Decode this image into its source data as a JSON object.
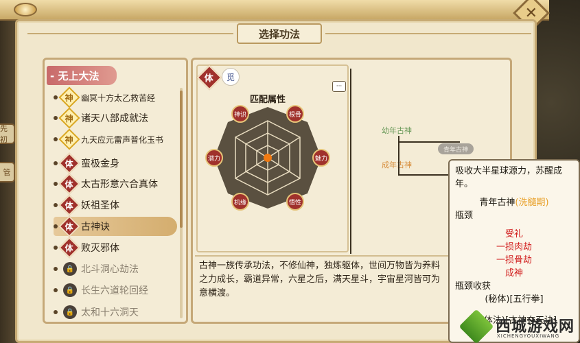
{
  "header": {
    "title": "选择功法",
    "close_icon": "close-x-icon"
  },
  "left_tabs": [
    "先初",
    "管"
  ],
  "list": {
    "section_label": "- 无上大法",
    "items": [
      {
        "badge": "神",
        "kind": "shen",
        "label": "幽冥十方太乙救苦经",
        "small": true,
        "locked": false
      },
      {
        "badge": "神",
        "kind": "shen",
        "label": "诸天八部成就法",
        "small": false,
        "locked": false
      },
      {
        "badge": "神",
        "kind": "shen",
        "label": "九天应元雷声普化玉书",
        "small": true,
        "locked": false
      },
      {
        "badge": "体",
        "kind": "ti",
        "label": "蛮极金身",
        "small": false,
        "locked": false
      },
      {
        "badge": "体",
        "kind": "ti",
        "label": "太古形意六合真体",
        "small": false,
        "locked": false
      },
      {
        "badge": "体",
        "kind": "ti",
        "label": "妖祖圣体",
        "small": false,
        "locked": false
      },
      {
        "badge": "体",
        "kind": "ti",
        "label": "古神诀",
        "small": false,
        "locked": false,
        "selected": true
      },
      {
        "badge": "体",
        "kind": "ti",
        "label": "败灭邪体",
        "small": false,
        "locked": false
      },
      {
        "badge": "",
        "kind": "lock",
        "label": "北斗洞心劫法",
        "small": false,
        "locked": true
      },
      {
        "badge": "",
        "kind": "lock",
        "label": "长生六道轮回经",
        "small": false,
        "locked": true
      },
      {
        "badge": "",
        "kind": "lock",
        "label": "太和十六洞天",
        "small": false,
        "locked": true
      }
    ]
  },
  "detail": {
    "type_badge": "体",
    "stamp": "觅",
    "attr_title": "匹配属性",
    "chat_icon": "···",
    "radar_labels": [
      "神识",
      "根骨",
      "魅力",
      "悟性",
      "机缘",
      "潜力"
    ],
    "description": "古神一族传承功法，不修仙神，独炼躯体，世间万物皆为养料\n之力成长，霸道异常，六星之后，满天星斗，宇宙星河皆可为\n意横渡。",
    "stages": {
      "young": "幼年古神",
      "adult": "成年古神",
      "pill": "青年古神"
    }
  },
  "tooltip": {
    "line1": "吸收大半星球源力，苏醒成年。",
    "stage_name": "青年古神",
    "stage_tag": "(洗髓期)",
    "bottleneck_label": "瓶颈",
    "bottlenecks": [
      "受礼",
      "一损肉劫",
      "一损骨劫",
      "成神"
    ],
    "reward_label": "瓶颈收获",
    "reward1": "(秘体)[五行拳]",
    "reward2": "(淬体法)[古神夺天诀]"
  },
  "watermark": {
    "name": "西城游戏网",
    "sub": "XICHENGYOUXIWANG"
  },
  "colors": {
    "accent_red": "#a0312c",
    "gold": "#d9a622",
    "bottleneck_red": "#d01818",
    "stage_orange": "#e8a028",
    "young_green": "#6a9a5a",
    "adult_orange": "#d89040"
  }
}
